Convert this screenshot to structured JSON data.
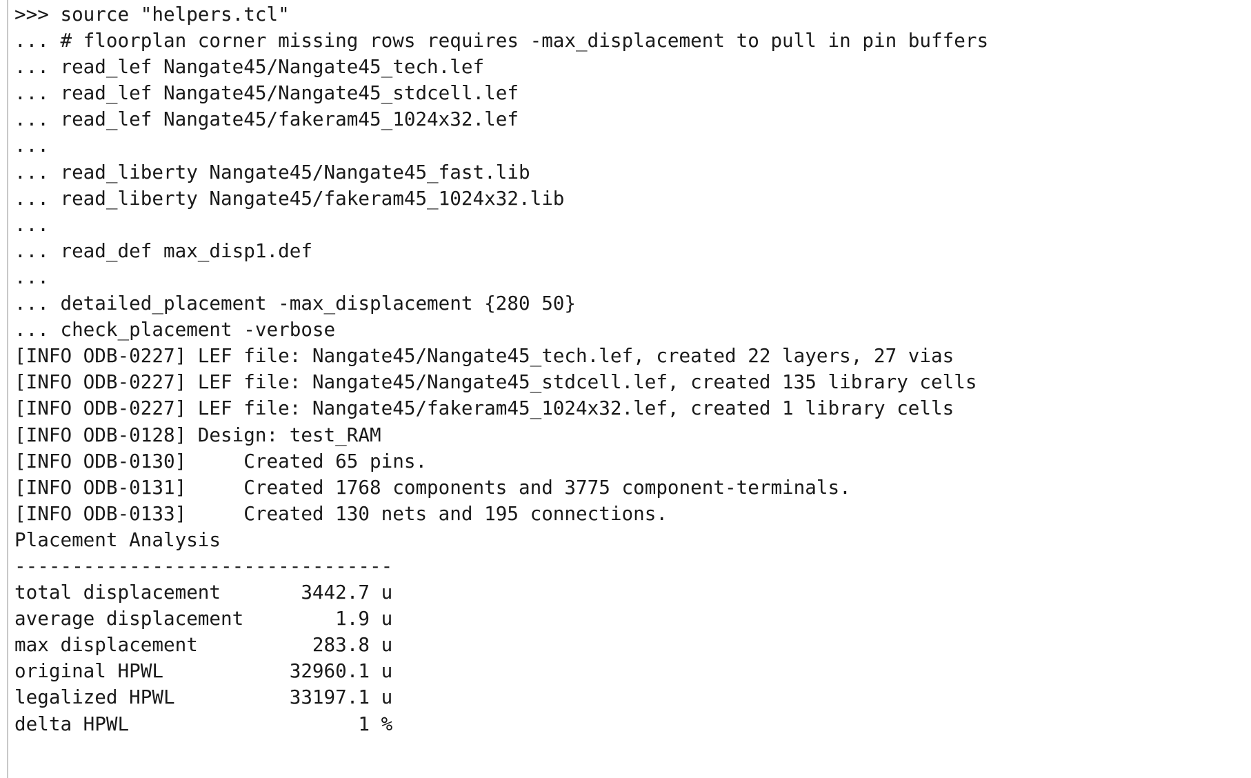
{
  "console": {
    "lines": [
      ">>> source \"helpers.tcl\"",
      "... # floorplan corner missing rows requires -max_displacement to pull in pin buffers",
      "... read_lef Nangate45/Nangate45_tech.lef",
      "... read_lef Nangate45/Nangate45_stdcell.lef",
      "... read_lef Nangate45/fakeram45_1024x32.lef",
      "...",
      "... read_liberty Nangate45/Nangate45_fast.lib",
      "... read_liberty Nangate45/fakeram45_1024x32.lib",
      "...",
      "... read_def max_disp1.def",
      "...",
      "... detailed_placement -max_displacement {280 50}",
      "... check_placement -verbose",
      "[INFO ODB-0227] LEF file: Nangate45/Nangate45_tech.lef, created 22 layers, 27 vias",
      "[INFO ODB-0227] LEF file: Nangate45/Nangate45_stdcell.lef, created 135 library cells",
      "[INFO ODB-0227] LEF file: Nangate45/fakeram45_1024x32.lef, created 1 library cells",
      "[INFO ODB-0128] Design: test_RAM",
      "[INFO ODB-0130]     Created 65 pins.",
      "[INFO ODB-0131]     Created 1768 components and 3775 component-terminals.",
      "[INFO ODB-0133]     Created 130 nets and 195 connections.",
      "Placement Analysis",
      "---------------------------------",
      "total displacement       3442.7 u",
      "average displacement        1.9 u",
      "max displacement          283.8 u",
      "original HPWL           32960.1 u",
      "legalized HPWL          33197.1 u",
      "delta HPWL                    1 %"
    ]
  }
}
